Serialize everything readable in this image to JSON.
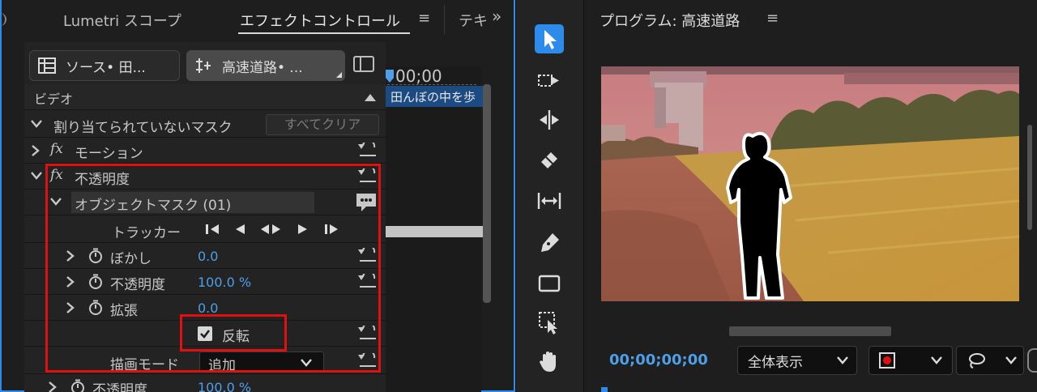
{
  "tabs": {
    "lumetri": "Lumetri スコープ",
    "effect_controls": "エフェクトコントロール",
    "menu_glyph": "≡",
    "text_partial": "テキ",
    "overflow": "»"
  },
  "source": {
    "source_btn": "ソース• 田...",
    "sequence_btn": "高速道路• ..."
  },
  "timeline": {
    "timecode": "00;00",
    "clip_label": "田んぼの中を歩"
  },
  "effects": {
    "video_header": "ビデオ",
    "unassigned_masks": "割り当てられていないマスク",
    "clear_all": "すべてクリア",
    "fx": "fx",
    "motion": "モーション",
    "opacity": "不透明度",
    "object_mask": "オブジェクトマスク (01)",
    "tracker": "トラッカー",
    "blur_label": "ぼかし",
    "blur_value": "0.0",
    "mask_opacity_label": "不透明度",
    "mask_opacity_value": "100.0 %",
    "expand_label": "拡張",
    "expand_value": "0.0",
    "invert_label": "反転",
    "invert_checked": true,
    "blend_mode_label": "描画モード",
    "blend_mode_value": "追加",
    "opacity2_label": "不透明度",
    "opacity2_value": "100.0 %"
  },
  "program": {
    "title": "プログラム: 高速道路",
    "menu_glyph": "≡",
    "timecode": "00;00;00;00",
    "zoom": "全体表示"
  },
  "colors": {
    "accent": "#2d8ceb",
    "value_blue": "#4f9fe8",
    "highlight_red": "#e01010",
    "timeline_clip": "#1c4a82"
  }
}
